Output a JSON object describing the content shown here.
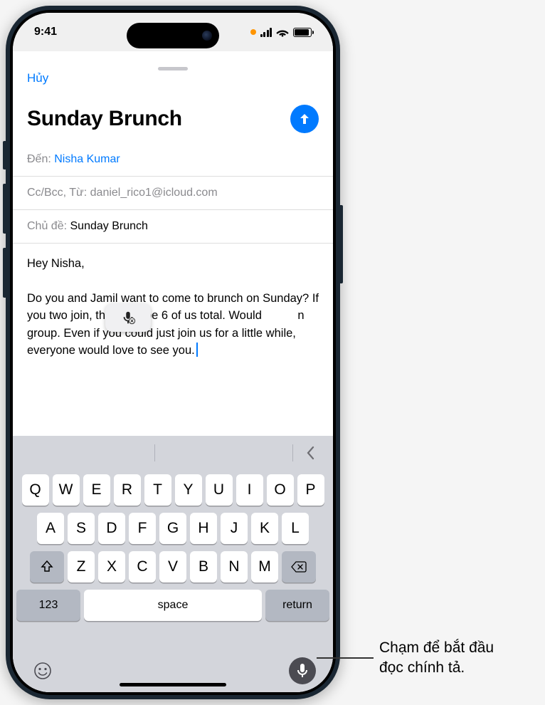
{
  "status": {
    "time": "9:41"
  },
  "compose": {
    "cancel": "Hủy",
    "title": "Sunday Brunch",
    "to_label": "Đến:",
    "to_value": "Nisha Kumar",
    "cc_label": "Cc/Bcc, Từ:",
    "cc_value": "daniel_rico1@icloud.com",
    "subject_label": "Chủ đề:",
    "subject_value": "Sunday Brunch",
    "body_pre": "Hey Nisha,\n\nDo you and Jamil want to come to brunch on Sunday? If you two join, there will be 6 of us total. Would",
    "body_mid": "n group. Even if you could just join us for a little while, everyone would love to see you.",
    "body_post": ""
  },
  "keyboard": {
    "row1": [
      "Q",
      "W",
      "E",
      "R",
      "T",
      "Y",
      "U",
      "I",
      "O",
      "P"
    ],
    "row2": [
      "A",
      "S",
      "D",
      "F",
      "G",
      "H",
      "J",
      "K",
      "L"
    ],
    "row3": [
      "Z",
      "X",
      "C",
      "V",
      "B",
      "N",
      "M"
    ],
    "num": "123",
    "space": "space",
    "return": "return"
  },
  "callout": {
    "line1": "Chạm để bắt đầu",
    "line2": "đọc chính tả."
  }
}
